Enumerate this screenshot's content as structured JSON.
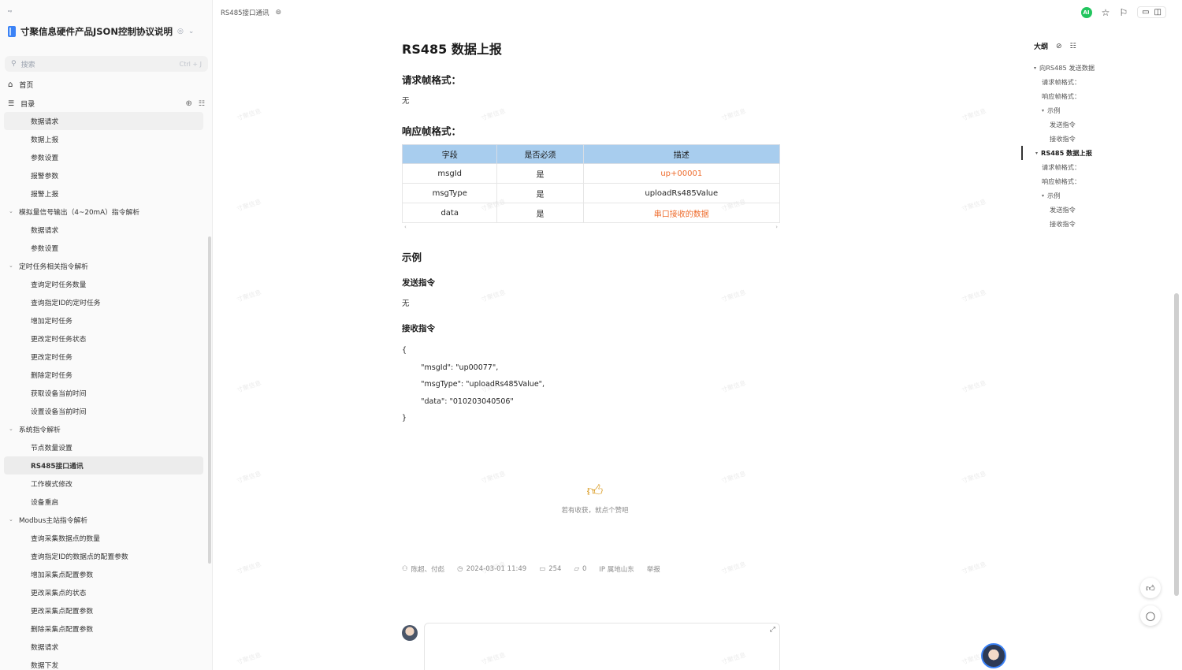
{
  "sidebar": {
    "logo_text": "ᵒᵍ",
    "book_title": "寸聚信息硬件产品JSON控制协议说明",
    "search_placeholder": "搜索",
    "search_shortcut": "Ctrl + J",
    "home_label": "首页",
    "toc_label": "目录",
    "toc": [
      {
        "label": "数据请求",
        "level": 2,
        "state": "hl"
      },
      {
        "label": "数据上报",
        "level": 2
      },
      {
        "label": "参数设置",
        "level": 2
      },
      {
        "label": "报警参数",
        "level": 2
      },
      {
        "label": "报警上报",
        "level": 2
      },
      {
        "label": "模拟量信号输出（4~20mA）指令解析",
        "level": 1,
        "caret": true
      },
      {
        "label": "数据请求",
        "level": 2
      },
      {
        "label": "参数设置",
        "level": 2
      },
      {
        "label": "定时任务相关指令解析",
        "level": 1,
        "caret": true
      },
      {
        "label": "查询定时任务数量",
        "level": 2
      },
      {
        "label": "查询指定ID的定时任务",
        "level": 2
      },
      {
        "label": "增加定时任务",
        "level": 2
      },
      {
        "label": "更改定时任务状态",
        "level": 2
      },
      {
        "label": "更改定时任务",
        "level": 2
      },
      {
        "label": "删除定时任务",
        "level": 2
      },
      {
        "label": "获取设备当前时间",
        "level": 2
      },
      {
        "label": "设置设备当前时间",
        "level": 2
      },
      {
        "label": "系统指令解析",
        "level": 1,
        "caret": true
      },
      {
        "label": "节点数量设置",
        "level": 2
      },
      {
        "label": "RS485接口通讯",
        "level": 2,
        "state": "active"
      },
      {
        "label": "工作模式修改",
        "level": 2
      },
      {
        "label": "设备重启",
        "level": 2
      },
      {
        "label": "Modbus主站指令解析",
        "level": 1,
        "caret": true
      },
      {
        "label": "查询采集数据点的数量",
        "level": 2
      },
      {
        "label": "查询指定ID的数据点的配置参数",
        "level": 2
      },
      {
        "label": "增加采集点配置参数",
        "level": 2
      },
      {
        "label": "更改采集点的状态",
        "level": 2
      },
      {
        "label": "更改采集点配置参数",
        "level": 2
      },
      {
        "label": "删除采集点配置参数",
        "level": 2
      },
      {
        "label": "数据请求",
        "level": 2
      },
      {
        "label": "数据下发",
        "level": 2
      }
    ]
  },
  "topbar": {
    "breadcrumb": "RS485接口通讯",
    "ai_label": "AI"
  },
  "doc": {
    "section_title": "RS485 数据上报",
    "request_heading": "请求帧格式：",
    "request_value": "无",
    "response_heading": "响应帧格式：",
    "table": {
      "headers": [
        "字段",
        "是否必须",
        "描述"
      ],
      "rows": [
        [
          "msgId",
          "是",
          "up+00001"
        ],
        [
          "msgType",
          "是",
          "uploadRs485Value"
        ],
        [
          "data",
          "是",
          "串口接收的数据"
        ]
      ]
    },
    "example_heading": "示例",
    "send_heading": "发送指令",
    "send_value": "无",
    "receive_heading": "接收指令",
    "code": "{\n        \"msgId\": \"up00077\",\n        \"msgType\": \"uploadRs485Value\",\n        \"data\": \"010203040506\"\n}",
    "like_text": "若有收获，就点个赞吧",
    "meta": {
      "authors": "陈超、付彪",
      "datetime": "2024-03-01 11:49",
      "views": "254",
      "comments": "0",
      "ip": "IP 属地山东",
      "report": "举报"
    }
  },
  "outline": {
    "title": "大纲",
    "items": [
      {
        "label": "向RS485 发送数据",
        "level": 1,
        "caret": true
      },
      {
        "label": "请求帧格式：",
        "level": 2
      },
      {
        "label": "响应帧格式：",
        "level": 2
      },
      {
        "label": "示例",
        "level": 2,
        "caret": true
      },
      {
        "label": "发送指令",
        "level": 3
      },
      {
        "label": "接收指令",
        "level": 3
      },
      {
        "label": "RS485 数据上报",
        "level": 1,
        "caret": true,
        "active": true
      },
      {
        "label": "请求帧格式：",
        "level": 2
      },
      {
        "label": "响应帧格式：",
        "level": 2
      },
      {
        "label": "示例",
        "level": 2,
        "caret": true
      },
      {
        "label": "发送指令",
        "level": 3
      },
      {
        "label": "接收指令",
        "level": 3
      }
    ]
  },
  "watermark": "寸聚信息",
  "colors": {
    "accent_orange": "#ee6c2d",
    "table_header": "#a8cdee",
    "ai_green": "#22c55e"
  }
}
